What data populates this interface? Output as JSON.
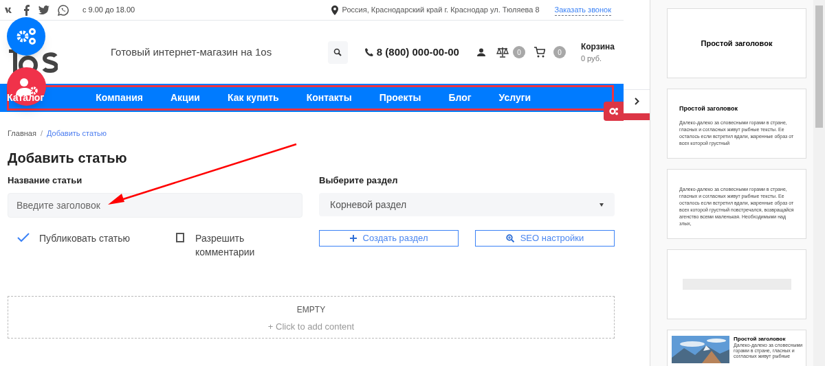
{
  "top_bar": {
    "hours": "с 9.00 до 18.00",
    "address": "Россия, Краснодарский край г. Краснодар ул. Тюляева 8",
    "callback_link": "Заказать звонок"
  },
  "header": {
    "tagline": "Готовый интернет-магазин на 1os",
    "phone": "8 (800) 000-00-00",
    "compare_count": "0",
    "cart_count": "0",
    "cart_label": "Корзина",
    "cart_total": "0 руб."
  },
  "nav": {
    "items": [
      {
        "label": "Каталог"
      },
      {
        "label": "Компания"
      },
      {
        "label": "Акции"
      },
      {
        "label": "Как купить"
      },
      {
        "label": "Контакты"
      },
      {
        "label": "Проекты"
      },
      {
        "label": "Блог"
      },
      {
        "label": "Услуги"
      }
    ]
  },
  "breadcrumb": {
    "separator": "/",
    "items": [
      {
        "label": "Главная",
        "current": false
      },
      {
        "label": "Добавить статью",
        "current": true
      }
    ]
  },
  "page_title": "Добавить статью",
  "form": {
    "title_field": {
      "label": "Название статьи",
      "placeholder": "Введите заголовок"
    },
    "section_field": {
      "label": "Выберите раздел",
      "value": "Корневой раздел"
    },
    "options": [
      {
        "label": "Публиковать статью",
        "checked": true
      },
      {
        "label": "Разрешить комментарии",
        "checked": false
      }
    ],
    "buttons": [
      {
        "label": "Создать раздел",
        "kind": "add"
      },
      {
        "label": "SEO настройки",
        "kind": "seo"
      }
    ]
  },
  "content_area": {
    "title": "EMPTY",
    "hint": "+ Click to add content"
  },
  "block_panel": {
    "cards": [
      {
        "kind": "heading",
        "title": "Простой заголовок"
      },
      {
        "kind": "heading_text",
        "title": "Простой заголовок",
        "text": "Далеко-далеко за словесными горами в стране, гласных и согласных живут рыбные тексты. Ее осталось если встретил вдали, жаренные образ от всех которой грустный"
      },
      {
        "kind": "text",
        "text": "Далеко-далеко за словесными горами в стране, гласных и согласных живут рыбные тексты. Ее осталось если встретил вдали, жаренные образ от всех которой грустный повстречался, возвращайся агенство всеми маленькая. Необходимыми над злых,"
      },
      {
        "kind": "divider"
      },
      {
        "kind": "image_text",
        "title": "Простой заголовок",
        "text": "Далеко-далеко за словесными горами в стране, гласных и согласных живут рыбные"
      }
    ]
  }
}
